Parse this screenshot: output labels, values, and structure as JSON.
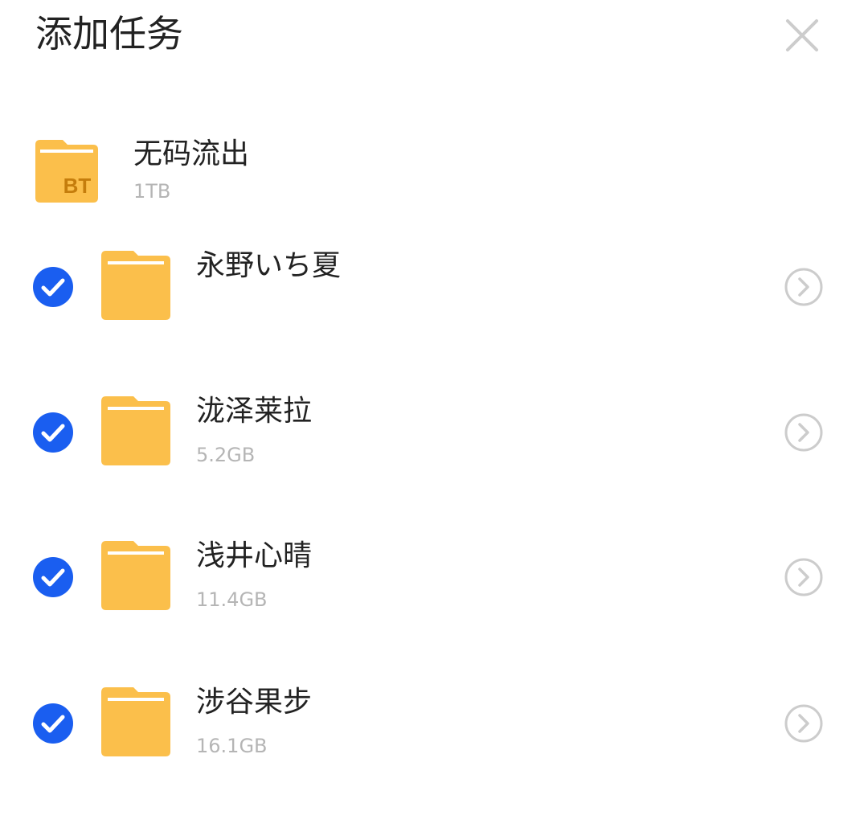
{
  "header": {
    "title": "添加任务",
    "close_icon": "close-icon"
  },
  "torrent": {
    "icon": "bt-folder-icon",
    "icon_label": "BT",
    "name": "无码流出",
    "size": "1TB"
  },
  "folders": [
    {
      "name": "永野いち夏",
      "size": "",
      "checked": true
    },
    {
      "name": "泷泽莱拉",
      "size": "5.2GB",
      "checked": true
    },
    {
      "name": "浅井心晴",
      "size": "11.4GB",
      "checked": true
    },
    {
      "name": "涉谷果步",
      "size": "16.1GB",
      "checked": true
    }
  ],
  "colors": {
    "check_blue": "#1a5ef0",
    "folder_yellow": "#fbbf4b",
    "size_gray": "#b5b5b5",
    "icon_gray": "#cccccc"
  }
}
